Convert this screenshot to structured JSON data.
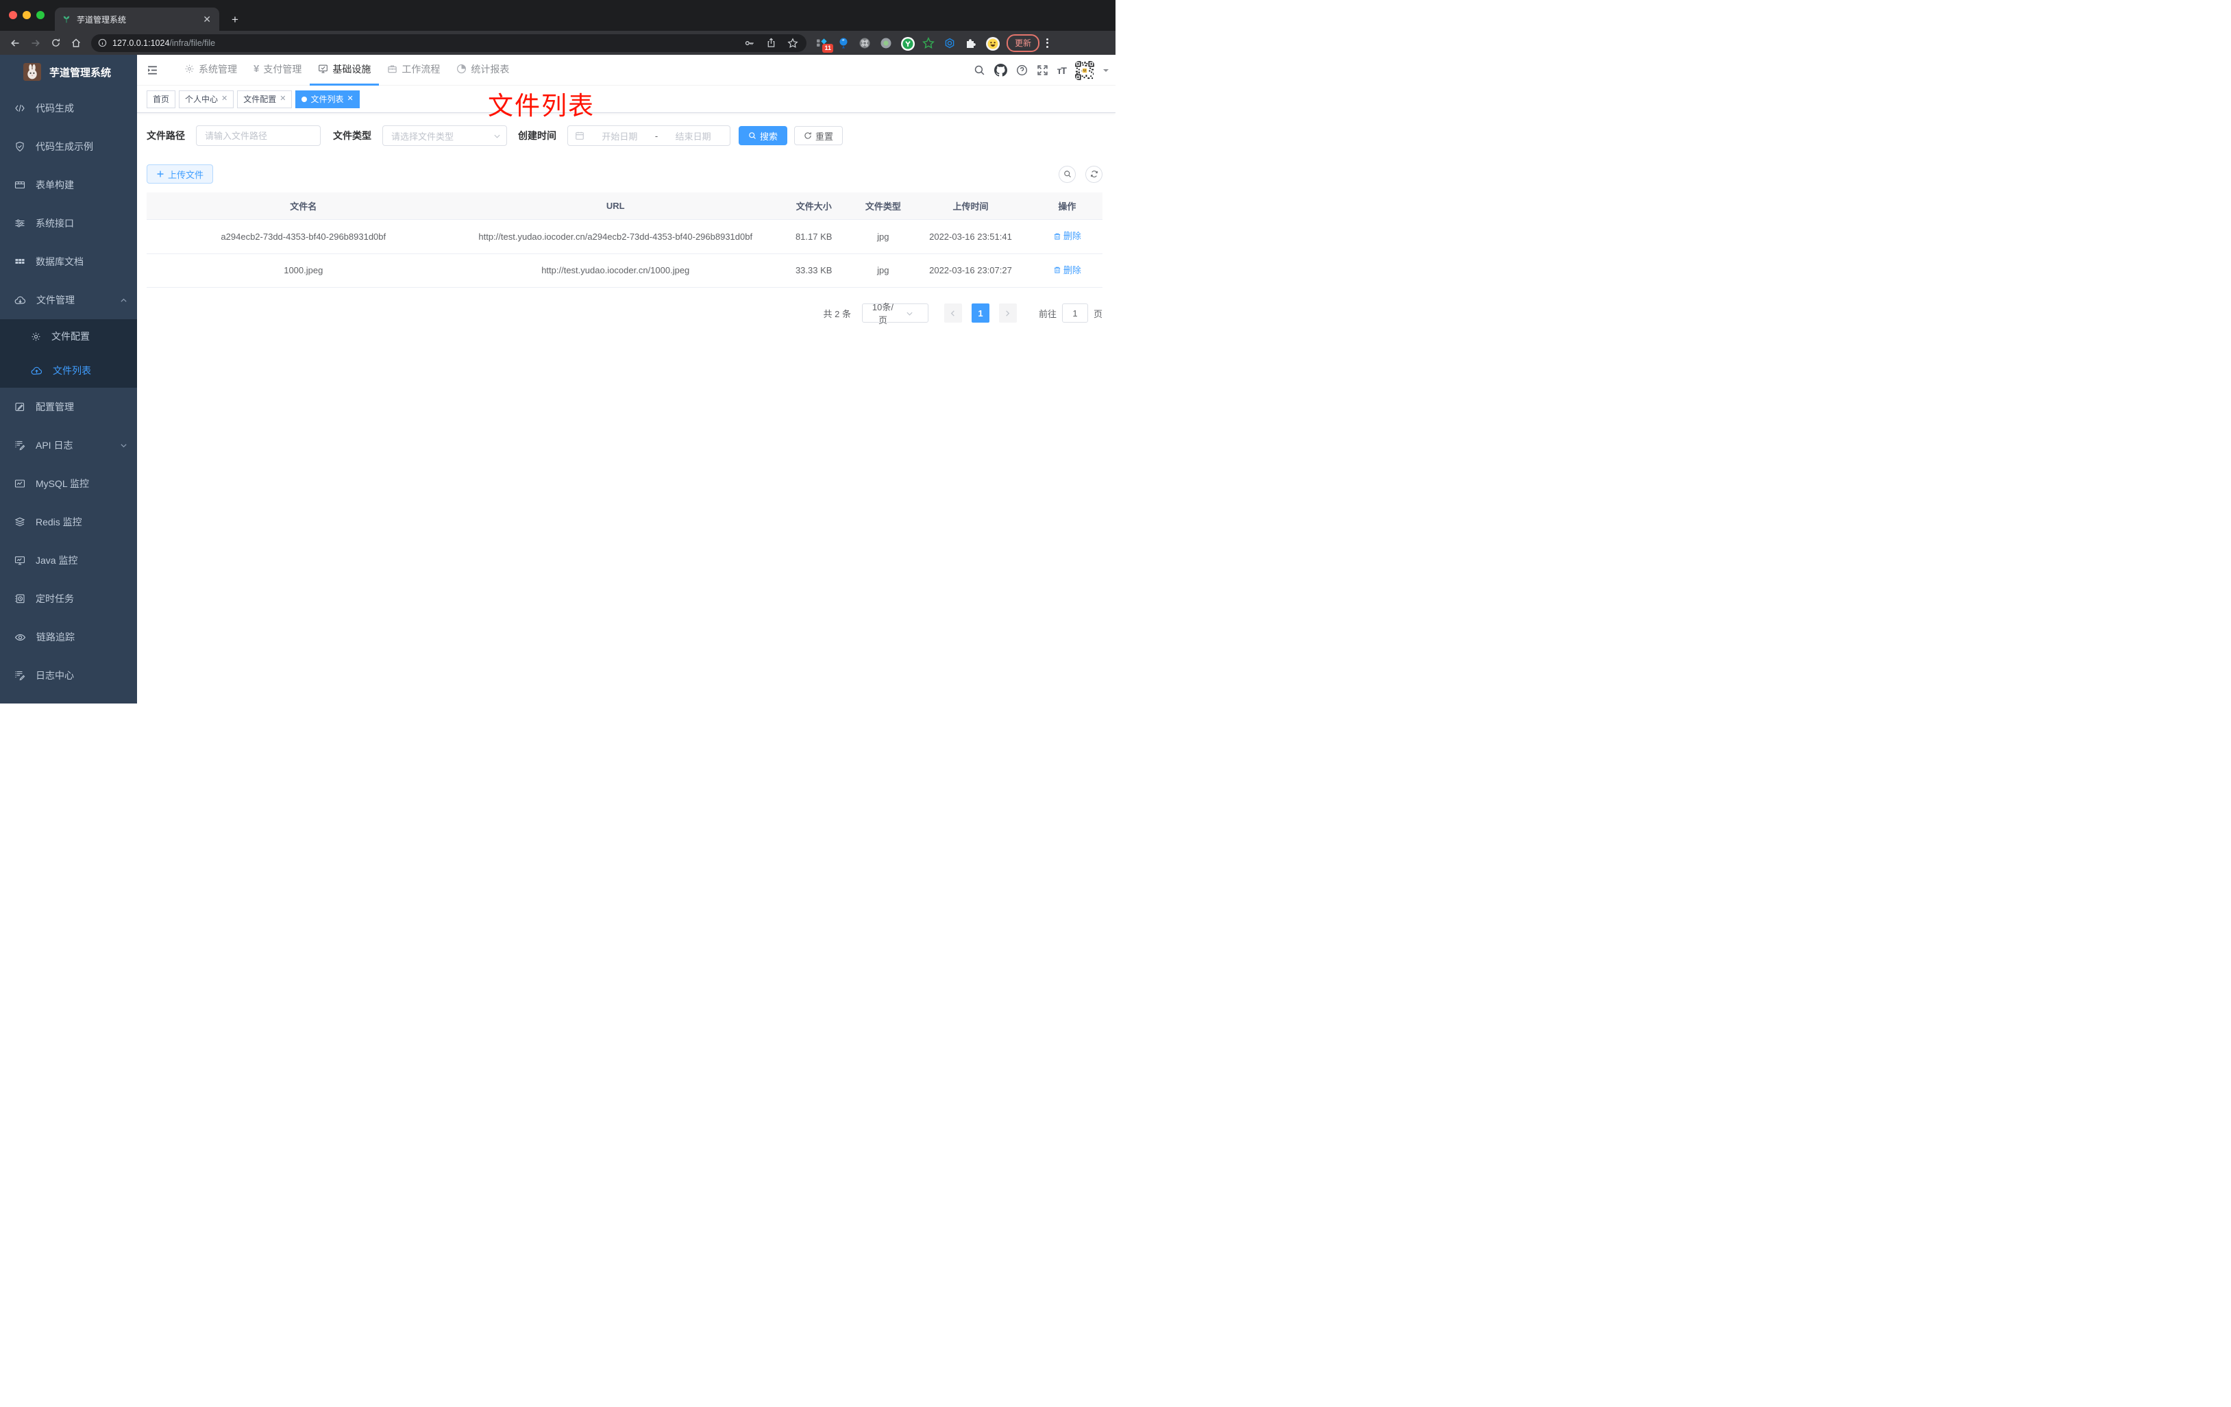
{
  "browser": {
    "tab_title": "芋道管理系统",
    "url_host": "127.0.0.1:1024",
    "url_path": "/infra/file/file",
    "extension_badge": "11",
    "update_label": "更新"
  },
  "sidebar": {
    "app_title": "芋道管理系统",
    "items": [
      {
        "label": "代码生成",
        "icon": "code-icon"
      },
      {
        "label": "代码生成示例",
        "icon": "shield-check-icon"
      },
      {
        "label": "表单构建",
        "icon": "form-icon"
      },
      {
        "label": "系统接口",
        "icon": "sliders-icon"
      },
      {
        "label": "数据库文档",
        "icon": "grid-icon"
      },
      {
        "label": "文件管理",
        "icon": "cloud-download-icon",
        "expanded": true
      },
      {
        "label": "文件配置",
        "icon": "gear-icon",
        "submenu": true
      },
      {
        "label": "文件列表",
        "icon": "cloud-upload-icon",
        "submenu": true,
        "active": true
      },
      {
        "label": "配置管理",
        "icon": "edit-square-icon"
      },
      {
        "label": "API 日志",
        "icon": "doc-edit-icon",
        "collapsed": true
      },
      {
        "label": "MySQL 监控",
        "icon": "chart-icon"
      },
      {
        "label": "Redis 监控",
        "icon": "layers-icon"
      },
      {
        "label": "Java 监控",
        "icon": "monitor-icon"
      },
      {
        "label": "定时任务",
        "icon": "schedule-icon"
      },
      {
        "label": "链路追踪",
        "icon": "eye-icon"
      },
      {
        "label": "日志中心",
        "icon": "doc-edit-icon"
      }
    ]
  },
  "navbar": {
    "menus": [
      {
        "label": "系统管理",
        "icon": "gear-icon"
      },
      {
        "label": "支付管理",
        "icon": "yen-icon"
      },
      {
        "label": "基础设施",
        "icon": "monitor-check-icon",
        "active": true
      },
      {
        "label": "工作流程",
        "icon": "briefcase-icon"
      },
      {
        "label": "统计报表",
        "icon": "pie-chart-icon"
      }
    ]
  },
  "tags": [
    {
      "label": "首页",
      "closable": false,
      "active": false
    },
    {
      "label": "个人中心",
      "closable": true,
      "active": false
    },
    {
      "label": "文件配置",
      "closable": true,
      "active": false
    },
    {
      "label": "文件列表",
      "closable": true,
      "active": true
    }
  ],
  "annotation": "文件列表",
  "filters": {
    "path_label": "文件路径",
    "path_placeholder": "请输入文件路径",
    "type_label": "文件类型",
    "type_placeholder": "请选择文件类型",
    "date_label": "创建时间",
    "date_start_placeholder": "开始日期",
    "date_separator": "-",
    "date_end_placeholder": "结束日期",
    "search_label": "搜索",
    "reset_label": "重置"
  },
  "toolbar": {
    "upload_label": "上传文件"
  },
  "table": {
    "headers": [
      "文件名",
      "URL",
      "文件大小",
      "文件类型",
      "上传时间",
      "操作"
    ],
    "rows": [
      {
        "name": "a294ecb2-73dd-4353-bf40-296b8931d0bf",
        "url": "http://test.yudao.iocoder.cn/a294ecb2-73dd-4353-bf40-296b8931d0bf",
        "size": "81.17 KB",
        "type": "jpg",
        "time": "2022-03-16 23:51:41",
        "action": "删除"
      },
      {
        "name": "1000.jpeg",
        "url": "http://test.yudao.iocoder.cn/1000.jpeg",
        "size": "33.33 KB",
        "type": "jpg",
        "time": "2022-03-16 23:07:27",
        "action": "删除"
      }
    ]
  },
  "pagination": {
    "total": "共 2 条",
    "page_size": "10条/页",
    "current_page": "1",
    "goto_label": "前往",
    "goto_value": "1",
    "page_unit": "页"
  },
  "colors": {
    "accent": "#409eff",
    "sidebar_bg": "#304156",
    "submenu_bg": "#1f2d3d",
    "annotation_red": "#ff1200",
    "update_pink": "#f2948d",
    "active_tag": "#409eff"
  }
}
